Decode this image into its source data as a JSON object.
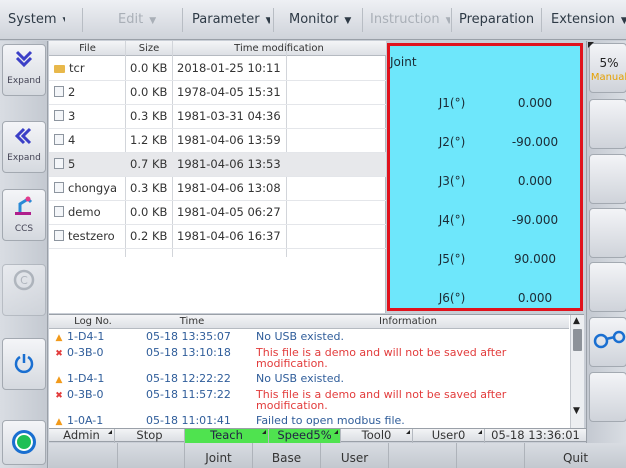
{
  "menu": [
    {
      "label": "System",
      "disabled": false
    },
    {
      "label": "Edit",
      "disabled": true
    },
    {
      "label": "Parameter",
      "disabled": false
    },
    {
      "label": "Monitor",
      "disabled": false
    },
    {
      "label": "Instruction",
      "disabled": true
    },
    {
      "label": "Preparation",
      "disabled": false
    },
    {
      "label": "Extension",
      "disabled": false
    }
  ],
  "left_panel": {
    "expand1": "Expand",
    "expand2": "Expand",
    "ccs": "CCS"
  },
  "right_panel": {
    "speed_value": "5%",
    "mode": "Manual"
  },
  "file_table": {
    "headers": {
      "file": "File",
      "size": "Size",
      "time": "Time modification"
    },
    "rows": [
      {
        "name": "tcr",
        "type": "folder",
        "size": "0.0 KB",
        "time": "2018-01-25 10:11",
        "selected": false
      },
      {
        "name": "2",
        "type": "file",
        "size": "0.0 KB",
        "time": "1978-04-05 15:31",
        "selected": false
      },
      {
        "name": "3",
        "type": "file",
        "size": "0.3 KB",
        "time": "1981-03-31 04:36",
        "selected": false
      },
      {
        "name": "4",
        "type": "file",
        "size": "1.2 KB",
        "time": "1981-04-06 13:59",
        "selected": false
      },
      {
        "name": "5",
        "type": "file",
        "size": "0.7 KB",
        "time": "1981-04-06 13:53",
        "selected": true
      },
      {
        "name": "chongya",
        "type": "file",
        "size": "0.3 KB",
        "time": "1981-04-06 13:08",
        "selected": false
      },
      {
        "name": "demo",
        "type": "file",
        "size": "0.0 KB",
        "time": "1981-04-05 06:27",
        "selected": false
      },
      {
        "name": "testzero",
        "type": "file",
        "size": "0.2 KB",
        "time": "1981-04-06 16:37",
        "selected": false
      }
    ]
  },
  "joint_panel": {
    "title": "Joint",
    "joints": [
      {
        "label": "J1(°)",
        "value": "0.000"
      },
      {
        "label": "J2(°)",
        "value": "-90.000"
      },
      {
        "label": "J3(°)",
        "value": "0.000"
      },
      {
        "label": "J4(°)",
        "value": "-90.000"
      },
      {
        "label": "J5(°)",
        "value": "90.000"
      },
      {
        "label": "J6(°)",
        "value": "0.000"
      }
    ]
  },
  "log_table": {
    "headers": {
      "no": "Log No.",
      "time": "Time",
      "info": "Information"
    },
    "rows": [
      {
        "severity": "warn",
        "no": "1-D4-1",
        "time": "05-18 13:35:07",
        "info": "No USB existed."
      },
      {
        "severity": "err",
        "no": "0-3B-0",
        "time": "05-18 13:10:18",
        "info": "This file is a demo and will not be saved after modification."
      },
      {
        "severity": "warn",
        "no": "1-D4-1",
        "time": "05-18 12:22:22",
        "info": "No USB existed."
      },
      {
        "severity": "err",
        "no": "0-3B-0",
        "time": "05-18 11:57:22",
        "info": "This file is a demo and will not be saved after modification."
      },
      {
        "severity": "warn",
        "no": "1-0A-1",
        "time": "05-18 11:01:41",
        "info": "Failed to open modbus file."
      }
    ]
  },
  "status_bar": {
    "user": "Admin",
    "state": "Stop",
    "mode": "Teach",
    "speed": "Speed5%",
    "tool": "Tool0",
    "user_frame": "User0",
    "datetime": "05-18 13:36:01"
  },
  "bottom_bar": {
    "joint": "Joint",
    "base": "Base",
    "user": "User",
    "quit": "Quit"
  },
  "colors": {
    "joint_panel_bg": "#6ee7fb",
    "joint_panel_border": "#e0121c",
    "status_green": "#4fe34f",
    "error_text": "#e23b3b",
    "warn_icon": "#f29a1a"
  }
}
